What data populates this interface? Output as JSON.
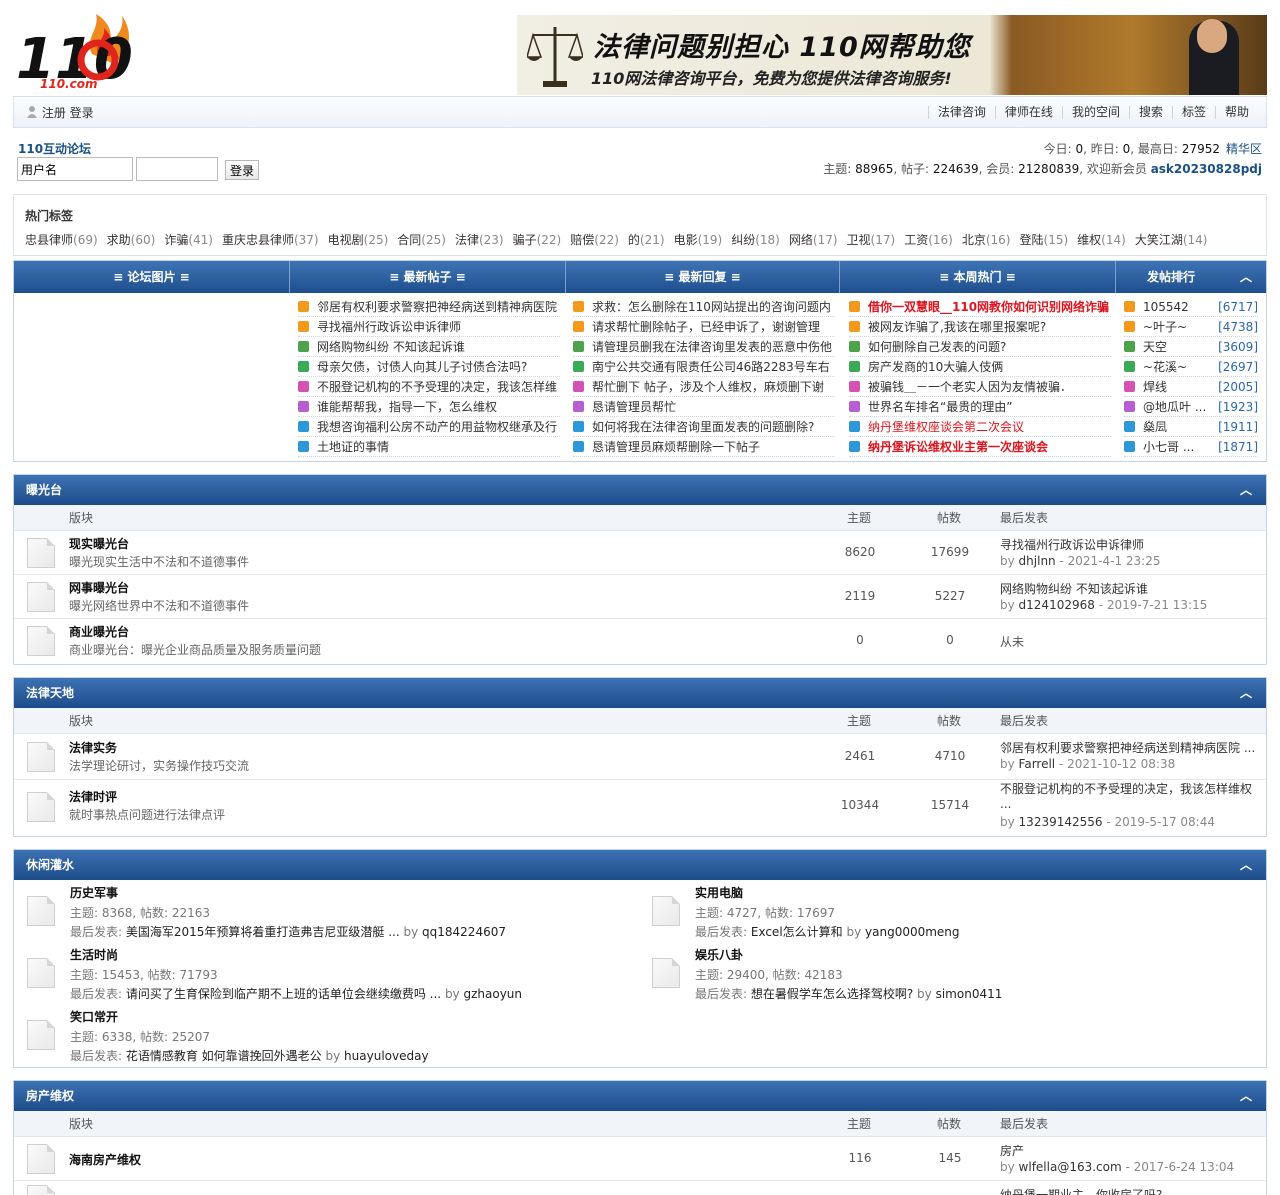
{
  "logo": {
    "text_big": "110",
    "text_small": "110.com"
  },
  "banner": {
    "headline": "法律问题别担心 110网帮助您",
    "subline": "110网法律咨询平台，免费为您提供法律咨询服务!"
  },
  "navbar": {
    "left": "注册 登录",
    "links": [
      "法律咨询",
      "律师在线",
      "我的空间",
      "搜索",
      "标签",
      "帮助"
    ]
  },
  "forum_link": "110互动论坛",
  "login": {
    "username_value": "用户名",
    "password_value": "",
    "button": "登录"
  },
  "stats": {
    "today_label": "今日: ",
    "today": "0",
    "yesterday_label": ", 昨日: ",
    "yesterday": "0",
    "max_label": ", 最高日: ",
    "max": "27952",
    "jinghua": "精华区",
    "threads_label": "主题: ",
    "threads": "88965",
    "posts_label": ", 帖子: ",
    "posts": "224639",
    "members_label": ", 会员: ",
    "members": "21280839",
    "welcome_label": ", 欢迎新会员 ",
    "newest": "ask20230828pdj"
  },
  "hot_tags": {
    "title": "热门标签",
    "items": [
      {
        "t": "忠县律师",
        "c": "(69)"
      },
      {
        "t": "求助",
        "c": "(60)"
      },
      {
        "t": "诈骗",
        "c": "(41)"
      },
      {
        "t": "重庆忠县律师",
        "c": "(37)"
      },
      {
        "t": "电视剧",
        "c": "(25)"
      },
      {
        "t": "合同",
        "c": "(25)"
      },
      {
        "t": "法律",
        "c": "(23)"
      },
      {
        "t": "骗子",
        "c": "(22)"
      },
      {
        "t": "赔偿",
        "c": "(22)"
      },
      {
        "t": "的",
        "c": "(21)"
      },
      {
        "t": "电影",
        "c": "(19)"
      },
      {
        "t": "纠纷",
        "c": "(18)"
      },
      {
        "t": "网络",
        "c": "(17)"
      },
      {
        "t": "卫视",
        "c": "(17)"
      },
      {
        "t": "工资",
        "c": "(16)"
      },
      {
        "t": "北京",
        "c": "(16)"
      },
      {
        "t": "登陆",
        "c": "(15)"
      },
      {
        "t": "维权",
        "c": "(14)"
      },
      {
        "t": "大笑江湖",
        "c": "(14)"
      }
    ]
  },
  "portal": {
    "heads": [
      "≡ 论坛图片 ≡",
      "≡ 最新帖子 ≡",
      "≡ 最新回复 ≡",
      "≡ 本周热门 ≡",
      "发帖排行",
      "︿"
    ],
    "newest": [
      "邻居有权利要求警察把神经病送到精神病医院",
      "寻找福州行政诉讼申诉律师",
      "网络购物纠纷 不知该起诉谁",
      "母亲欠债，讨债人向其儿子讨债合法吗?",
      "不服登记机构的不予受理的决定，我该怎样维",
      "谁能帮帮我，指导一下，怎么维权",
      "我想咨询福利公房不动产的用益物权继承及行",
      "土地证的事情"
    ],
    "replies": [
      "求救：怎么删除在110网站提出的咨询问题内",
      "请求帮忙删除帖子，已经申诉了，谢谢管理",
      "请管理员删我在法律咨询里发表的恶意中伤他",
      "南宁公共交通有限责任公司46路2283号车右",
      "帮忙删下 帖子，涉及个人维权，麻烦删下谢",
      "恳请管理员帮忙",
      "如何将我在法律咨询里面发表的问题删除?",
      "恳请管理员麻烦帮删除一下帖子"
    ],
    "hot": [
      "借你一双慧眼__110网教你如何识别网络诈骗",
      "被网友诈骗了,我该在哪里报案呢?",
      "如何删除自己发表的问题?",
      "房产发商的10大骗人伎俩",
      "被骗钱＿－一个老实人因为友情被骗．",
      "世界名车排名“最贵的理由”",
      "纳丹堡维权座谈会第二次会议",
      "纳丹堡诉讼维权业主第一次座谈会"
    ],
    "rank": [
      {
        "n": "105542",
        "c": "[6717]"
      },
      {
        "n": "~叶子~",
        "c": "[4738]"
      },
      {
        "n": "天空",
        "c": "[3609]"
      },
      {
        "n": "~花溪~",
        "c": "[2697]"
      },
      {
        "n": "焊线",
        "c": "[2005]"
      },
      {
        "n": "@地瓜叶 ...",
        "c": "[1923]"
      },
      {
        "n": "燊凨",
        "c": "[1911]"
      },
      {
        "n": "小七哥 ...",
        "c": "[1871]"
      }
    ]
  },
  "colhead": {
    "forum": "版块",
    "threads": "主题",
    "posts": "帖数",
    "last": "最后发表"
  },
  "sections": {
    "s1": {
      "title": "曝光台",
      "rows": [
        {
          "name": "现实曝光台",
          "desc": "曝光现实生活中不法和不道德事件",
          "threads": "8620",
          "posts": "17699",
          "last": "寻找福州行政诉讼申诉律师",
          "by": "dhjlnn",
          "time": " - 2021-4-1 23:25"
        },
        {
          "name": "网事曝光台",
          "desc": "曝光网络世界中不法和不道德事件",
          "threads": "2119",
          "posts": "5227",
          "last": "网络购物纠纷 不知该起诉谁",
          "by": "d124102968",
          "time": " - 2019-7-21 13:15"
        },
        {
          "name": "商业曝光台",
          "desc": "商业曝光台：曝光企业商品质量及服务质量问题",
          "threads": "0",
          "posts": "0",
          "last": "从未"
        }
      ]
    },
    "s2": {
      "title": "法律天地",
      "rows": [
        {
          "name": "法律实务",
          "desc": "法学理论研讨，实务操作技巧交流",
          "threads": "2461",
          "posts": "4710",
          "last": "邻居有权利要求警察把神经病送到精神病医院 ...",
          "by": "Farrell",
          "time": " - 2021-10-12 08:38"
        },
        {
          "name": "法律时评",
          "desc": "就时事热点问题进行法律点评",
          "threads": "10344",
          "posts": "15714",
          "last": "不服登记机构的不予受理的决定，我该怎样维权",
          "last2": "...",
          "by": "13239142556",
          "time": " - 2019-5-17 08:44"
        }
      ]
    },
    "s3": {
      "title": "休闲灌水",
      "cells": [
        {
          "name": "历史军事",
          "stat": "主题: 8368, 帖数: 22163",
          "last": "美国海军2015年预算将着重打造弗吉尼亚级潜艇 ...",
          "by": "qq184224607"
        },
        {
          "name": "实用电脑",
          "stat": "主题: 4727, 帖数: 17697",
          "last": "Excel怎么计算和",
          "by": "yang0000meng"
        },
        {
          "name": "生活时尚",
          "stat": "主题: 15453, 帖数: 71793",
          "last": "请问买了生育保险到临产期不上班的话单位会继续缴费吗 ...",
          "by": "gzhaoyun"
        },
        {
          "name": "娱乐八卦",
          "stat": "主题: 29400, 帖数: 42183",
          "last": "想在暑假学车怎么选择驾校啊?",
          "by": "simon0411"
        },
        {
          "name": "笑口常开",
          "stat": "主题: 6338, 帖数: 25207",
          "last": "花语情感教育 如何靠谱挽回外遇老公",
          "by": "huayuloveday"
        }
      ],
      "last_label": "最后发表: ",
      "by_label": " by "
    },
    "s4": {
      "title": "房产维权",
      "rows": [
        {
          "name": "海南房产维权",
          "threads": "116",
          "posts": "145",
          "last": "房产",
          "by": "wlfella@163.com",
          "time": " - 2017-6-24 13:04"
        },
        {
          "next_last": "纳丹堡一期业主，你收房了吗?"
        }
      ]
    }
  },
  "by_word": "by ",
  "collapse_icon": "︿",
  "colors": {
    "header_blue": "#1e4f8e",
    "link_blue": "#1a5089",
    "hot_red": "#e0141e"
  }
}
